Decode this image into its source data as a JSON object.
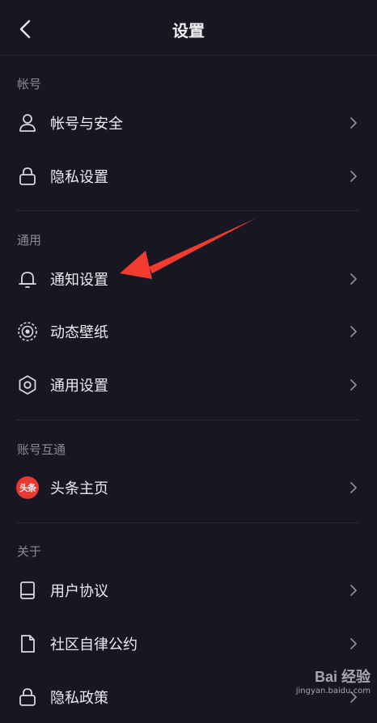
{
  "header": {
    "title": "设置"
  },
  "sections": {
    "account": {
      "label": "帐号"
    },
    "general": {
      "label": "通用"
    },
    "linked": {
      "label": "账号互通"
    },
    "about": {
      "label": "关于"
    }
  },
  "rows": {
    "account_security": {
      "label": "帐号与安全",
      "icon": "user-icon"
    },
    "privacy_settings": {
      "label": "隐私设置",
      "icon": "lock-icon"
    },
    "notification_settings": {
      "label": "通知设置",
      "icon": "bell-icon"
    },
    "live_wallpaper": {
      "label": "动态壁纸",
      "icon": "wallpaper-icon"
    },
    "general_settings": {
      "label": "通用设置",
      "icon": "gear-icon"
    },
    "toutiao_home": {
      "label": "头条主页",
      "icon": "toutiao-icon",
      "icon_text": "头条"
    },
    "user_agreement": {
      "label": "用户协议",
      "icon": "book-icon"
    },
    "community_rules": {
      "label": "社区自律公约",
      "icon": "document-icon"
    },
    "privacy_policy": {
      "label": "隐私政策",
      "icon": "shield-icon"
    }
  },
  "watermark": {
    "logo": "Bai 经验",
    "url": "jingyan.baidu.com"
  },
  "colors": {
    "background": "#171724",
    "annotation_arrow": "#f23a2e"
  }
}
